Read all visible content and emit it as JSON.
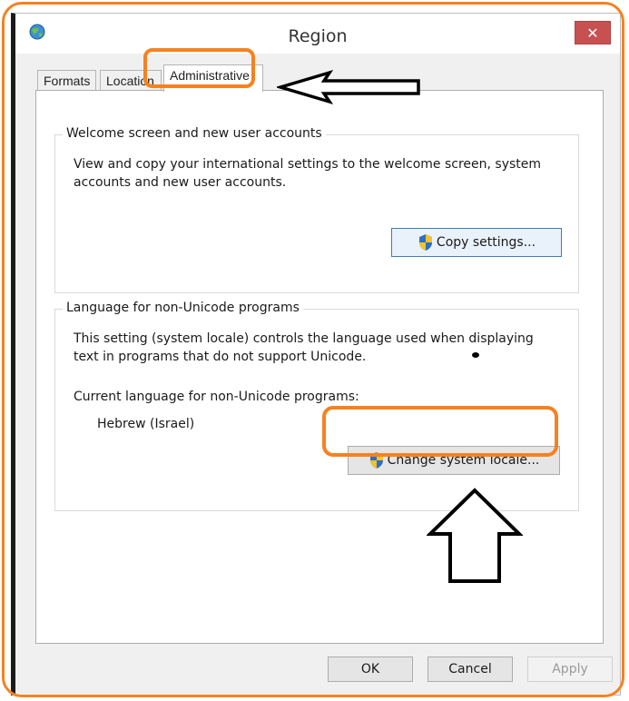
{
  "window": {
    "title": "Region",
    "close_label": "✕"
  },
  "tabs": [
    {
      "label": "Formats"
    },
    {
      "label": "Location"
    },
    {
      "label": "Administrative"
    }
  ],
  "welcome_group": {
    "title": "Welcome screen and new user accounts",
    "description_line1": "View and copy your international settings to the welcome screen, system",
    "description_line2": "accounts and new user accounts.",
    "copy_button_label": "Copy settings..."
  },
  "unicode_group": {
    "title": "Language for non-Unicode programs",
    "description_line1": "This setting (system locale) controls the language used when displaying",
    "description_line2": "text in programs that do not support Unicode.",
    "current_label": "Current language for non-Unicode programs:",
    "current_value": "Hebrew (Israel)",
    "change_button_label": "Change system locale..."
  },
  "footer": {
    "ok_label": "OK",
    "cancel_label": "Cancel",
    "apply_label": "Apply"
  },
  "colors": {
    "highlight": "#f58220",
    "close": "#c75050"
  }
}
